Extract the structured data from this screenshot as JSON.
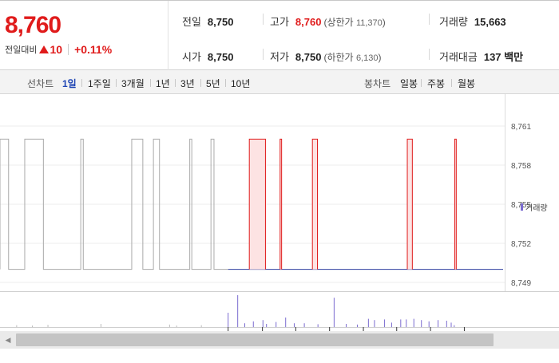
{
  "quote": {
    "current_price": "8,760",
    "change_label": "전일대비",
    "change_value": "10",
    "change_percent": "+0.11%",
    "direction_icon": "up-triangle-icon",
    "color_up": "#e01b1b"
  },
  "stats": {
    "prev_close": {
      "label": "전일",
      "value": "8,750"
    },
    "open": {
      "label": "시가",
      "value": "8,750"
    },
    "high": {
      "label": "고가",
      "value": "8,760",
      "limit_label": "(상한가",
      "limit_value": "11,370",
      "limit_close": ")"
    },
    "low": {
      "label": "저가",
      "value": "8,750",
      "limit_label": "(하한가",
      "limit_value": "6,130",
      "limit_close": ")"
    },
    "volume": {
      "label": "거래량",
      "value": "15,663"
    },
    "amount": {
      "label": "거래대금",
      "value": "137 백만"
    }
  },
  "line_chart_tabs": {
    "label": "선차트",
    "items": [
      "1일",
      "1주일",
      "3개월",
      "1년",
      "3년",
      "5년",
      "10년"
    ],
    "active": "1일"
  },
  "candle_chart_tabs": {
    "label": "봉차트",
    "items": [
      "일봉",
      "주봉",
      "월봉"
    ]
  },
  "chart_data": {
    "type": "line",
    "y_ticks": [
      "8,761",
      "8,758",
      "8,755",
      "8,752",
      "8,749"
    ],
    "ylim": [
      8749,
      8761
    ],
    "price_levels": [
      8750,
      8760
    ],
    "prev_close": 8750,
    "gray_highs": [
      [
        0.0,
        0.017
      ],
      [
        0.049,
        0.086
      ],
      [
        0.16,
        0.165
      ],
      [
        0.261,
        0.283
      ],
      [
        0.304,
        0.316
      ],
      [
        0.376,
        0.38
      ],
      [
        0.418,
        0.424
      ]
    ],
    "red_highs": [
      [
        0.494,
        0.526
      ],
      [
        0.555,
        0.558
      ],
      [
        0.619,
        0.629
      ],
      [
        0.807,
        0.817
      ],
      [
        0.901,
        0.904
      ]
    ],
    "session_split": 0.452,
    "volume_legend": "거래량",
    "volume_color": "#7a6bd0",
    "up_color": "#e01b1b",
    "prev_color": "#aaaaaa",
    "base_color": "#3040a0",
    "volume_bars": [
      [
        0.033,
        0.06
      ],
      [
        0.064,
        0.05
      ],
      [
        0.095,
        0.07
      ],
      [
        0.2,
        0.1
      ],
      [
        0.336,
        0.08
      ],
      [
        0.35,
        0.05
      ],
      [
        0.399,
        0.06
      ],
      [
        0.452,
        0.45
      ],
      [
        0.471,
        1.0
      ],
      [
        0.485,
        0.12
      ],
      [
        0.502,
        0.18
      ],
      [
        0.521,
        0.22
      ],
      [
        0.528,
        0.1
      ],
      [
        0.547,
        0.16
      ],
      [
        0.566,
        0.3
      ],
      [
        0.583,
        0.12
      ],
      [
        0.603,
        0.12
      ],
      [
        0.63,
        0.09
      ],
      [
        0.662,
        0.92
      ],
      [
        0.686,
        0.1
      ],
      [
        0.708,
        0.08
      ],
      [
        0.73,
        0.26
      ],
      [
        0.742,
        0.22
      ],
      [
        0.762,
        0.24
      ],
      [
        0.776,
        0.14
      ],
      [
        0.794,
        0.24
      ],
      [
        0.805,
        0.24
      ],
      [
        0.82,
        0.26
      ],
      [
        0.835,
        0.22
      ],
      [
        0.85,
        0.18
      ],
      [
        0.868,
        0.22
      ],
      [
        0.885,
        0.2
      ],
      [
        0.894,
        0.14
      ],
      [
        0.9,
        0.06
      ]
    ],
    "time_ticks": [
      0.452,
      0.52,
      0.586,
      0.653,
      0.72,
      0.786,
      0.853,
      0.92
    ]
  }
}
